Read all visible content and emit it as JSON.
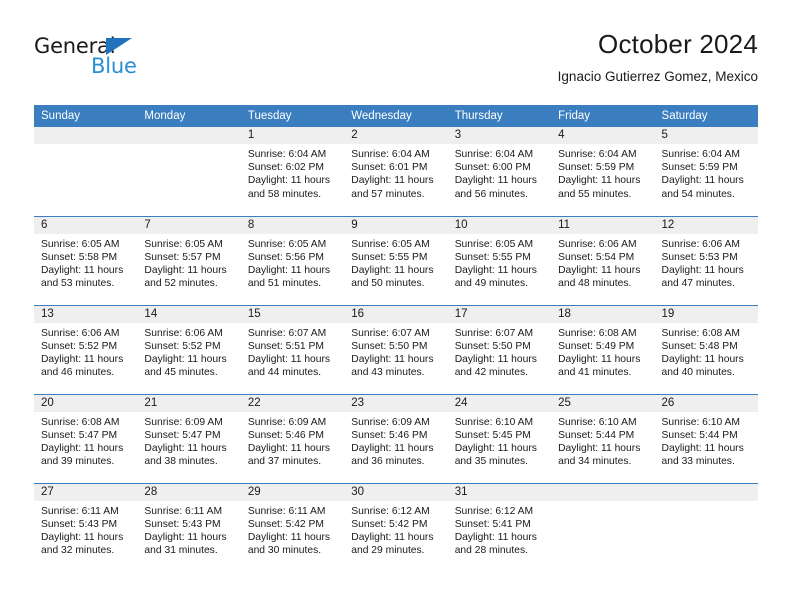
{
  "brand": {
    "name_top": "General",
    "name_bottom": "Blue",
    "triangle_color": "#1f72bb",
    "blue_color": "#2a8fd4"
  },
  "header": {
    "title": "October 2024",
    "subtitle": "Ignacio Gutierrez Gomez, Mexico"
  },
  "theme": {
    "header_bg": "#3a7ebf",
    "daynum_bg": "#efefef",
    "grid_line": "#3a7ebf",
    "text": "#1a1a1a"
  },
  "weekdays": [
    "Sunday",
    "Monday",
    "Tuesday",
    "Wednesday",
    "Thursday",
    "Friday",
    "Saturday"
  ],
  "labels": {
    "sunrise_prefix": "Sunrise:",
    "sunset_prefix": "Sunset:",
    "daylight_prefix": "Daylight:"
  },
  "weeks": [
    [
      {
        "day": "",
        "sunrise": "",
        "sunset": "",
        "daylight": ""
      },
      {
        "day": "",
        "sunrise": "",
        "sunset": "",
        "daylight": ""
      },
      {
        "day": "1",
        "sunrise": "Sunrise: 6:04 AM",
        "sunset": "Sunset: 6:02 PM",
        "daylight": "Daylight: 11 hours and 58 minutes."
      },
      {
        "day": "2",
        "sunrise": "Sunrise: 6:04 AM",
        "sunset": "Sunset: 6:01 PM",
        "daylight": "Daylight: 11 hours and 57 minutes."
      },
      {
        "day": "3",
        "sunrise": "Sunrise: 6:04 AM",
        "sunset": "Sunset: 6:00 PM",
        "daylight": "Daylight: 11 hours and 56 minutes."
      },
      {
        "day": "4",
        "sunrise": "Sunrise: 6:04 AM",
        "sunset": "Sunset: 5:59 PM",
        "daylight": "Daylight: 11 hours and 55 minutes."
      },
      {
        "day": "5",
        "sunrise": "Sunrise: 6:04 AM",
        "sunset": "Sunset: 5:59 PM",
        "daylight": "Daylight: 11 hours and 54 minutes."
      }
    ],
    [
      {
        "day": "6",
        "sunrise": "Sunrise: 6:05 AM",
        "sunset": "Sunset: 5:58 PM",
        "daylight": "Daylight: 11 hours and 53 minutes."
      },
      {
        "day": "7",
        "sunrise": "Sunrise: 6:05 AM",
        "sunset": "Sunset: 5:57 PM",
        "daylight": "Daylight: 11 hours and 52 minutes."
      },
      {
        "day": "8",
        "sunrise": "Sunrise: 6:05 AM",
        "sunset": "Sunset: 5:56 PM",
        "daylight": "Daylight: 11 hours and 51 minutes."
      },
      {
        "day": "9",
        "sunrise": "Sunrise: 6:05 AM",
        "sunset": "Sunset: 5:55 PM",
        "daylight": "Daylight: 11 hours and 50 minutes."
      },
      {
        "day": "10",
        "sunrise": "Sunrise: 6:05 AM",
        "sunset": "Sunset: 5:55 PM",
        "daylight": "Daylight: 11 hours and 49 minutes."
      },
      {
        "day": "11",
        "sunrise": "Sunrise: 6:06 AM",
        "sunset": "Sunset: 5:54 PM",
        "daylight": "Daylight: 11 hours and 48 minutes."
      },
      {
        "day": "12",
        "sunrise": "Sunrise: 6:06 AM",
        "sunset": "Sunset: 5:53 PM",
        "daylight": "Daylight: 11 hours and 47 minutes."
      }
    ],
    [
      {
        "day": "13",
        "sunrise": "Sunrise: 6:06 AM",
        "sunset": "Sunset: 5:52 PM",
        "daylight": "Daylight: 11 hours and 46 minutes."
      },
      {
        "day": "14",
        "sunrise": "Sunrise: 6:06 AM",
        "sunset": "Sunset: 5:52 PM",
        "daylight": "Daylight: 11 hours and 45 minutes."
      },
      {
        "day": "15",
        "sunrise": "Sunrise: 6:07 AM",
        "sunset": "Sunset: 5:51 PM",
        "daylight": "Daylight: 11 hours and 44 minutes."
      },
      {
        "day": "16",
        "sunrise": "Sunrise: 6:07 AM",
        "sunset": "Sunset: 5:50 PM",
        "daylight": "Daylight: 11 hours and 43 minutes."
      },
      {
        "day": "17",
        "sunrise": "Sunrise: 6:07 AM",
        "sunset": "Sunset: 5:50 PM",
        "daylight": "Daylight: 11 hours and 42 minutes."
      },
      {
        "day": "18",
        "sunrise": "Sunrise: 6:08 AM",
        "sunset": "Sunset: 5:49 PM",
        "daylight": "Daylight: 11 hours and 41 minutes."
      },
      {
        "day": "19",
        "sunrise": "Sunrise: 6:08 AM",
        "sunset": "Sunset: 5:48 PM",
        "daylight": "Daylight: 11 hours and 40 minutes."
      }
    ],
    [
      {
        "day": "20",
        "sunrise": "Sunrise: 6:08 AM",
        "sunset": "Sunset: 5:47 PM",
        "daylight": "Daylight: 11 hours and 39 minutes."
      },
      {
        "day": "21",
        "sunrise": "Sunrise: 6:09 AM",
        "sunset": "Sunset: 5:47 PM",
        "daylight": "Daylight: 11 hours and 38 minutes."
      },
      {
        "day": "22",
        "sunrise": "Sunrise: 6:09 AM",
        "sunset": "Sunset: 5:46 PM",
        "daylight": "Daylight: 11 hours and 37 minutes."
      },
      {
        "day": "23",
        "sunrise": "Sunrise: 6:09 AM",
        "sunset": "Sunset: 5:46 PM",
        "daylight": "Daylight: 11 hours and 36 minutes."
      },
      {
        "day": "24",
        "sunrise": "Sunrise: 6:10 AM",
        "sunset": "Sunset: 5:45 PM",
        "daylight": "Daylight: 11 hours and 35 minutes."
      },
      {
        "day": "25",
        "sunrise": "Sunrise: 6:10 AM",
        "sunset": "Sunset: 5:44 PM",
        "daylight": "Daylight: 11 hours and 34 minutes."
      },
      {
        "day": "26",
        "sunrise": "Sunrise: 6:10 AM",
        "sunset": "Sunset: 5:44 PM",
        "daylight": "Daylight: 11 hours and 33 minutes."
      }
    ],
    [
      {
        "day": "27",
        "sunrise": "Sunrise: 6:11 AM",
        "sunset": "Sunset: 5:43 PM",
        "daylight": "Daylight: 11 hours and 32 minutes."
      },
      {
        "day": "28",
        "sunrise": "Sunrise: 6:11 AM",
        "sunset": "Sunset: 5:43 PM",
        "daylight": "Daylight: 11 hours and 31 minutes."
      },
      {
        "day": "29",
        "sunrise": "Sunrise: 6:11 AM",
        "sunset": "Sunset: 5:42 PM",
        "daylight": "Daylight: 11 hours and 30 minutes."
      },
      {
        "day": "30",
        "sunrise": "Sunrise: 6:12 AM",
        "sunset": "Sunset: 5:42 PM",
        "daylight": "Daylight: 11 hours and 29 minutes."
      },
      {
        "day": "31",
        "sunrise": "Sunrise: 6:12 AM",
        "sunset": "Sunset: 5:41 PM",
        "daylight": "Daylight: 11 hours and 28 minutes."
      },
      {
        "day": "",
        "sunrise": "",
        "sunset": "",
        "daylight": ""
      },
      {
        "day": "",
        "sunrise": "",
        "sunset": "",
        "daylight": ""
      }
    ]
  ]
}
